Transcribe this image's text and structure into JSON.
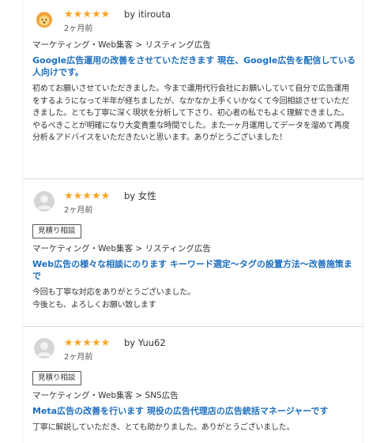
{
  "colors": {
    "star": "#f5a623",
    "link_title": "#1e6fbe",
    "divider": "#dcdcdc"
  },
  "reviews": [
    {
      "avatar_icon": "lion-avatar-icon",
      "stars": "★★★★★",
      "rating": 5,
      "by": "by itirouta",
      "date": "2ヶ月前",
      "badge": "",
      "category": "マーケティング・Web集客 > リスティング広告",
      "title": "Google広告運用の改善をさせていただきます 現在、Google広告を配信している人向けです。",
      "body": "初めてお願いさせていただきました。今まで運用代行会社にお願いしていて自分で広告運用をするようになって半年が経ちましたが、なかなか上手くいかなくて今回相談させていただきました。とても丁寧に深く現状を分析して下さり、初心者の私でもよく理解できました。やるべきことが明確になり大変貴重な時間でした。また一ヶ月運用してデータを溜めて再度分析＆アドバイスをいただきたいと思います。ありがとうございました！"
    },
    {
      "avatar_icon": "default-user-avatar-icon",
      "stars": "★★★★★",
      "rating": 5,
      "by": "by 女性",
      "date": "2ヶ月前",
      "badge": "見積り相談",
      "category": "マーケティング・Web集客 > リスティング広告",
      "title": "Web広告の様々な相談にのります キーワード選定〜タグの設置方法〜改善施策まで",
      "body_lines": [
        "今回も丁寧な対応をありがとうございました。",
        "今後とも、よろしくお願い致します"
      ]
    },
    {
      "avatar_icon": "default-user-avatar-icon",
      "stars": "★★★★★",
      "rating": 5,
      "by": "by Yuu62",
      "date": "2ヶ月前",
      "badge": "見積り相談",
      "category": "マーケティング・Web集客 > SNS広告",
      "title": "Meta広告の改善を行います 現役の広告代理店の広告統括マネージャーです",
      "body": "丁寧に解説していただき、とても助かりました。ありがとうございました。"
    }
  ]
}
